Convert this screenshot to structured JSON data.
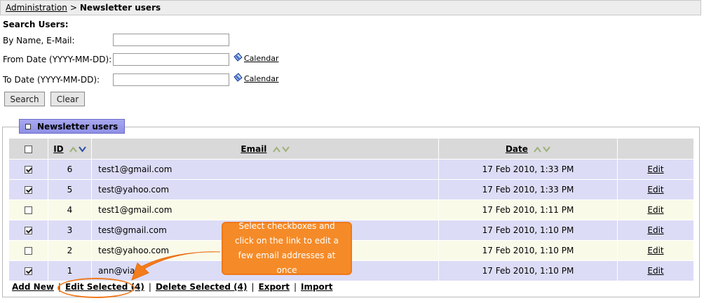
{
  "breadcrumb": {
    "root": "Administration",
    "separator": ">",
    "current": "Newsletter users"
  },
  "search": {
    "heading": "Search Users:",
    "name_label": "By Name, E-Mail:",
    "from_label": "From Date (YYYY-MM-DD):",
    "to_label": "To Date (YYYY-MM-DD):",
    "name_value": "",
    "from_value": "",
    "to_value": "",
    "calendar_label": "Calendar",
    "search_button": "Search",
    "clear_button": "Clear"
  },
  "panel": {
    "tab_label": "Newsletter users"
  },
  "table": {
    "columns": {
      "id": "ID",
      "email": "Email",
      "date": "Date"
    },
    "rows": [
      {
        "checked": true,
        "id": "6",
        "email": "test1@gmail.com",
        "date": "17 Feb 2010, 1:33 PM",
        "action": "Edit"
      },
      {
        "checked": true,
        "id": "5",
        "email": "test@yahoo.com",
        "date": "17 Feb 2010, 1:33 PM",
        "action": "Edit"
      },
      {
        "checked": false,
        "id": "4",
        "email": "test1@gmail.com",
        "date": "17 Feb 2010, 1:11 PM",
        "action": "Edit"
      },
      {
        "checked": true,
        "id": "3",
        "email": "test@gmail.com",
        "date": "17 Feb 2010, 1:10 PM",
        "action": "Edit"
      },
      {
        "checked": false,
        "id": "2",
        "email": "test@yahoo.com",
        "date": "17 Feb 2010, 1:10 PM",
        "action": "Edit"
      },
      {
        "checked": true,
        "id": "1",
        "email": "ann@viart",
        "date": "17 Feb 2010, 1:10 PM",
        "action": "Edit"
      }
    ]
  },
  "footer": {
    "add_new": "Add New",
    "edit_selected": "Edit Selected (4)",
    "delete_selected": "Delete Selected (4)",
    "export": "Export",
    "import": "Import",
    "separator": "|"
  },
  "callout": {
    "text": "Select checkboxes and click on the link to edit a few email addresses at once"
  },
  "colors": {
    "selected_row": "#dcdcf6",
    "unselected_row": "#fafae8",
    "header": "#d9d9d9",
    "tab": "#9a9aea",
    "callout": "#f58b28",
    "sort_active": "#2b4ea0",
    "sort_inactive": "#9db17a"
  },
  "icons": {
    "calendar": "calendar-icon",
    "sort_up": "sort-asc-icon",
    "sort_down": "sort-desc-icon"
  }
}
